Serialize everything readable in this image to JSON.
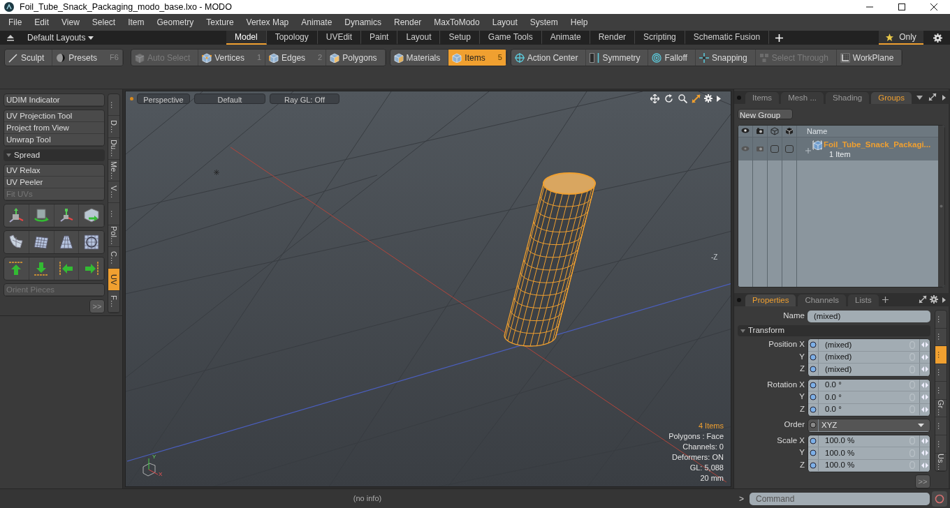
{
  "window": {
    "title": "Foil_Tube_Snack_Packaging_modo_base.lxo - MODO"
  },
  "menu": [
    "File",
    "Edit",
    "View",
    "Select",
    "Item",
    "Geometry",
    "Texture",
    "Vertex Map",
    "Animate",
    "Dynamics",
    "Render",
    "MaxToModo",
    "Layout",
    "System",
    "Help"
  ],
  "layout_bar": {
    "preset": "Default Layouts",
    "tabs": [
      {
        "label": "Model",
        "selected": true
      },
      {
        "label": "Topology",
        "selected": false
      },
      {
        "label": "UVEdit",
        "selected": false
      },
      {
        "label": "Paint",
        "selected": false
      },
      {
        "label": "Layout",
        "selected": false
      },
      {
        "label": "Setup",
        "selected": false
      },
      {
        "label": "Game Tools",
        "selected": false
      },
      {
        "label": "Animate",
        "selected": false
      },
      {
        "label": "Render",
        "selected": false
      },
      {
        "label": "Scripting",
        "selected": false
      },
      {
        "label": "Schematic Fusion",
        "selected": false
      }
    ],
    "only": {
      "label": "Only",
      "selected": true
    }
  },
  "toolbar": {
    "groups": [
      {
        "buttons": [
          {
            "label": "Sculpt",
            "selected": false,
            "disabled": false
          },
          {
            "label": "Presets",
            "shortcut": "F6",
            "selected": false,
            "disabled": false
          }
        ]
      },
      {
        "buttons": [
          {
            "label": "Auto Select",
            "selected": false,
            "disabled": true
          },
          {
            "label": "Vertices",
            "shortcut": "1",
            "selected": false,
            "disabled": false
          },
          {
            "label": "Edges",
            "shortcut": "2",
            "selected": false,
            "disabled": false
          },
          {
            "label": "Polygons",
            "selected": false,
            "disabled": false
          }
        ]
      },
      {
        "buttons": [
          {
            "label": "Materials",
            "selected": false,
            "disabled": false
          },
          {
            "label": "Items",
            "shortcut": "5",
            "selected": true,
            "disabled": false
          }
        ]
      },
      {
        "buttons": [
          {
            "label": "Action Center",
            "selected": false,
            "disabled": false
          },
          {
            "label": "Symmetry",
            "selected": false,
            "disabled": false
          },
          {
            "label": "Falloff",
            "selected": false,
            "disabled": false
          },
          {
            "label": "Snapping",
            "selected": false,
            "disabled": false
          },
          {
            "label": "Select Through",
            "selected": false,
            "disabled": true
          },
          {
            "label": "WorkPlane",
            "selected": false,
            "disabled": false
          }
        ]
      }
    ]
  },
  "tool_panel": {
    "groups": [
      {
        "kind": "list",
        "items": [
          {
            "label": "UDIM Indicator",
            "disabled": false
          }
        ]
      },
      {
        "kind": "list",
        "items": [
          {
            "label": "UV Projection Tool",
            "disabled": false
          },
          {
            "label": "Project from View",
            "disabled": false
          },
          {
            "label": "Unwrap Tool",
            "disabled": false
          }
        ]
      },
      {
        "kind": "header",
        "label": "Spread",
        "expanded": true
      },
      {
        "kind": "list",
        "items": [
          {
            "label": "UV Relax",
            "disabled": false
          },
          {
            "label": "UV Peeler",
            "disabled": false
          },
          {
            "label": "Fit UVs",
            "disabled": true
          }
        ]
      },
      {
        "kind": "icon_row"
      },
      {
        "kind": "icon_row"
      },
      {
        "kind": "icon_row"
      },
      {
        "kind": "list",
        "items": [
          {
            "label": "Orient Pieces",
            "disabled": true
          }
        ]
      }
    ],
    "more": ">>",
    "side_tabs": [
      {
        "label": "…",
        "selected": false
      },
      {
        "label": "D…",
        "selected": false
      },
      {
        "label": "Du…",
        "selected": false
      },
      {
        "label": "Me…",
        "selected": false
      },
      {
        "label": "V…",
        "selected": false
      },
      {
        "label": "…",
        "selected": false
      },
      {
        "label": "Pol…",
        "selected": false
      },
      {
        "label": "C…",
        "selected": false
      },
      {
        "label": "UV",
        "selected": true
      },
      {
        "label": "F…",
        "selected": false
      }
    ]
  },
  "viewport": {
    "view": "Perspective",
    "shading": "Default",
    "ray_gl": "Ray GL: Off",
    "axis_marker": "-Z",
    "gizmo": {
      "y": "Y",
      "x": "X"
    },
    "stats": [
      {
        "text": "4 Items",
        "highlighted": true
      },
      {
        "text": "Polygons : Face",
        "highlighted": false
      },
      {
        "text": "Channels: 0",
        "highlighted": false
      },
      {
        "text": "Deformers: ON",
        "highlighted": false
      },
      {
        "text": "GL: 5,088",
        "highlighted": false
      },
      {
        "text": "20 mm",
        "highlighted": false
      }
    ]
  },
  "status": "(no info)",
  "groups_panel": {
    "tabs": [
      {
        "label": "Items",
        "selected": false
      },
      {
        "label": "Mesh ...",
        "selected": false
      },
      {
        "label": "Shading",
        "selected": false
      },
      {
        "label": "Groups",
        "selected": true
      }
    ],
    "new_group": "New Group",
    "name_column": "Name",
    "rows": [
      {
        "name": "Foil_Tube_Snack_Packagi...",
        "count": "1 Item",
        "selected": true
      }
    ]
  },
  "properties_panel": {
    "tabs": [
      {
        "label": "Properties",
        "selected": true
      },
      {
        "label": "Channels",
        "selected": false
      },
      {
        "label": "Lists",
        "selected": false
      }
    ],
    "name_label": "Name",
    "name_value": "(mixed)",
    "section": {
      "label": "Transform",
      "expanded": true
    },
    "groups": [
      {
        "kind": "vector",
        "rows": [
          {
            "label": "Position X",
            "value": "(mixed)"
          },
          {
            "label": "Y",
            "value": "(mixed)"
          },
          {
            "label": "Z",
            "value": "(mixed)"
          }
        ]
      },
      {
        "kind": "vector",
        "rows": [
          {
            "label": "Rotation X",
            "value": "0.0 °"
          },
          {
            "label": "Y",
            "value": "0.0 °"
          },
          {
            "label": "Z",
            "value": "0.0 °"
          }
        ]
      },
      {
        "kind": "dropdown",
        "rows": [
          {
            "label": "Order",
            "value": "XYZ"
          }
        ]
      },
      {
        "kind": "vector",
        "rows": [
          {
            "label": "Scale X",
            "value": "100.0 %"
          },
          {
            "label": "Y",
            "value": "100.0 %"
          },
          {
            "label": "Z",
            "value": "100.0 %"
          }
        ]
      }
    ],
    "more": ">>",
    "side_tabs": [
      {
        "label": "…",
        "selected": false
      },
      {
        "label": "…",
        "selected": false
      },
      {
        "label": "…",
        "selected": true
      },
      {
        "label": "…",
        "selected": false
      },
      {
        "label": "…",
        "selected": false
      },
      {
        "label": "Gr…",
        "selected": false
      },
      {
        "label": "…",
        "selected": false
      },
      {
        "label": "…",
        "selected": false
      },
      {
        "label": "Us…",
        "selected": false
      }
    ]
  },
  "command": {
    "prompt": ">",
    "placeholder": "Command"
  }
}
